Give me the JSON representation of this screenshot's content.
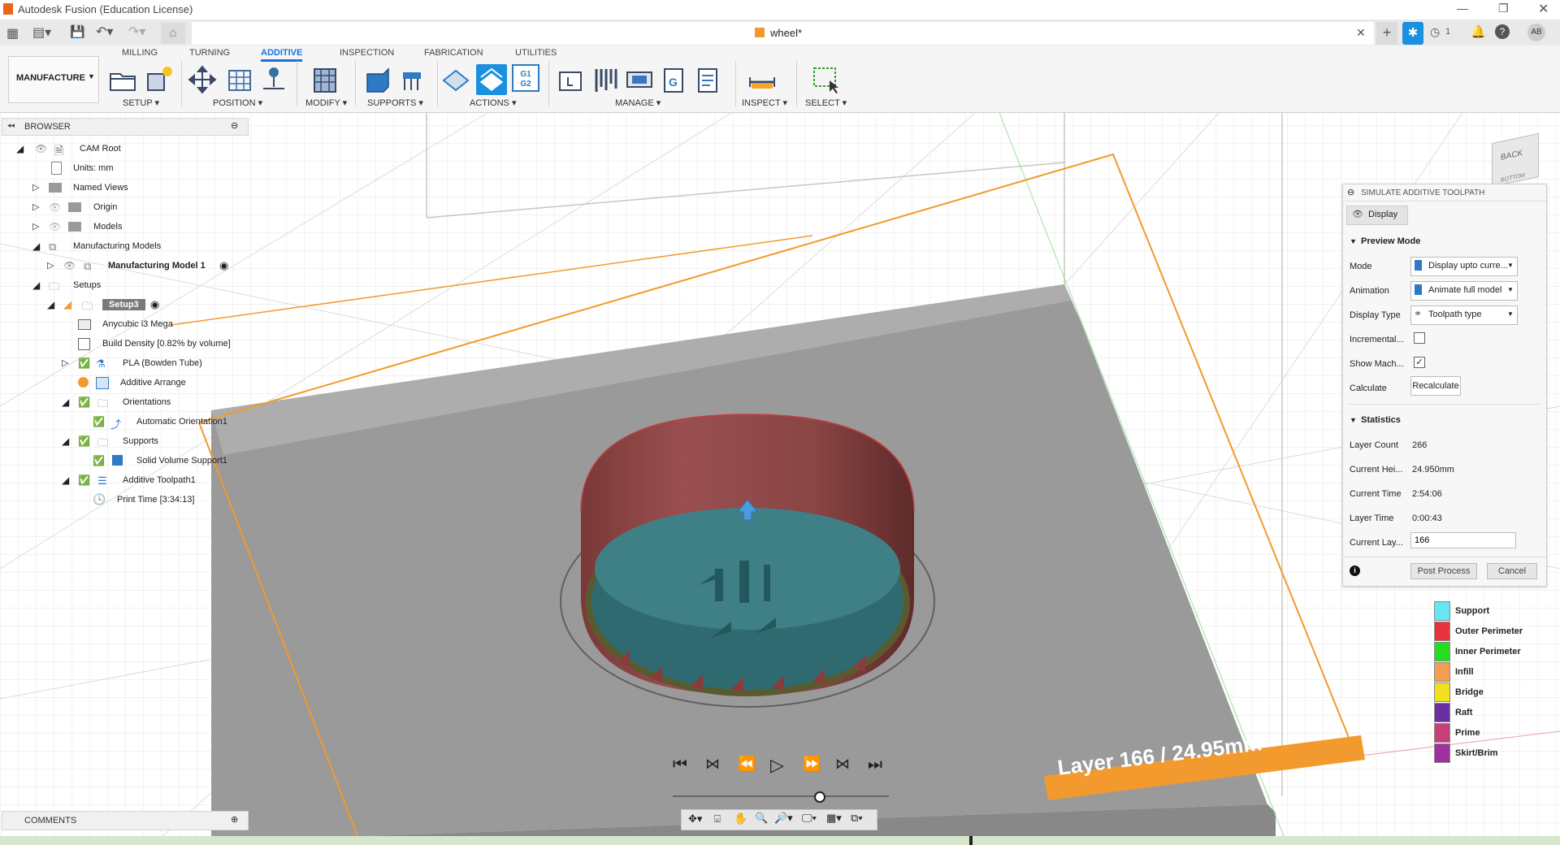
{
  "titlebar": {
    "title": "Autodesk Fusion (Education License)"
  },
  "document": {
    "tab_title": "wheel*",
    "user_initials": "AB",
    "jobs_count": "1"
  },
  "ribbon": {
    "tabs": [
      "MILLING",
      "TURNING",
      "ADDITIVE",
      "INSPECTION",
      "FABRICATION",
      "UTILITIES"
    ],
    "workspace": "MANUFACTURE",
    "groups": {
      "setup": "SETUP ▾",
      "position": "POSITION ▾",
      "modify": "MODIFY ▾",
      "supports": "SUPPORTS ▾",
      "actions": "ACTIONS ▾",
      "manage": "MANAGE ▾",
      "inspect": "INSPECT ▾",
      "select": "SELECT ▾"
    },
    "g1g2": "G1\nG2"
  },
  "browser": {
    "title": "BROWSER",
    "items": [
      {
        "label": "CAM Root"
      },
      {
        "label": "Units: mm"
      },
      {
        "label": "Named Views"
      },
      {
        "label": "Origin"
      },
      {
        "label": "Models"
      },
      {
        "label": "Manufacturing Models"
      },
      {
        "label": "Manufacturing Model 1"
      },
      {
        "label": "Setups"
      },
      {
        "label": "Setup3"
      },
      {
        "label": "Anycubic i3 Mega"
      },
      {
        "label": "Build Density [0.82% by volume]"
      },
      {
        "label": "PLA (Bowden Tube)"
      },
      {
        "label": "Additive Arrange"
      },
      {
        "label": "Orientations"
      },
      {
        "label": "Automatic Orientation1"
      },
      {
        "label": "Supports"
      },
      {
        "label": "Solid Volume Support1"
      },
      {
        "label": "Additive Toolpath1"
      },
      {
        "label": "Print Time [3:34:13]"
      }
    ],
    "comments": "COMMENTS"
  },
  "viewcube": {
    "back": "BACK",
    "bottom": "BOTTOM"
  },
  "sim": {
    "title": "SIMULATE ADDITIVE TOOLPATH",
    "tab": "Display",
    "preview_heading": "Preview Mode",
    "mode_label": "Mode",
    "mode_value": "Display upto curre...",
    "animation_label": "Animation",
    "animation_value": "Animate full model",
    "display_type_label": "Display Type",
    "display_type_value": "Toolpath type",
    "incremental_label": "Incremental...",
    "show_machine_label": "Show Mach...",
    "calculate_label": "Calculate",
    "recalculate": "Recalculate",
    "stats_heading": "Statistics",
    "layer_count_label": "Layer Count",
    "layer_count": "266",
    "current_height_label": "Current Hei...",
    "current_height": "24.950mm",
    "current_time_label": "Current Time",
    "current_time": "2:54:06",
    "layer_time_label": "Layer Time",
    "layer_time": "0:00:43",
    "current_layer_label": "Current Lay...",
    "current_layer": "166",
    "post_process": "Post Process",
    "cancel": "Cancel"
  },
  "legend": [
    {
      "label": "Support",
      "color": "#66e6f0"
    },
    {
      "label": "Outer Perimeter",
      "color": "#e8333a"
    },
    {
      "label": "Inner Perimeter",
      "color": "#22dd22"
    },
    {
      "label": "Infill",
      "color": "#f0a050"
    },
    {
      "label": "Bridge",
      "color": "#f0e020"
    },
    {
      "label": "Raft",
      "color": "#6a2fa0"
    },
    {
      "label": "Prime",
      "color": "#c8407a"
    },
    {
      "label": "Skirt/Brim",
      "color": "#a030a0"
    }
  ],
  "layer_banner": "Layer 166 / 24.95mm",
  "playback": {
    "progress": 0.68
  }
}
